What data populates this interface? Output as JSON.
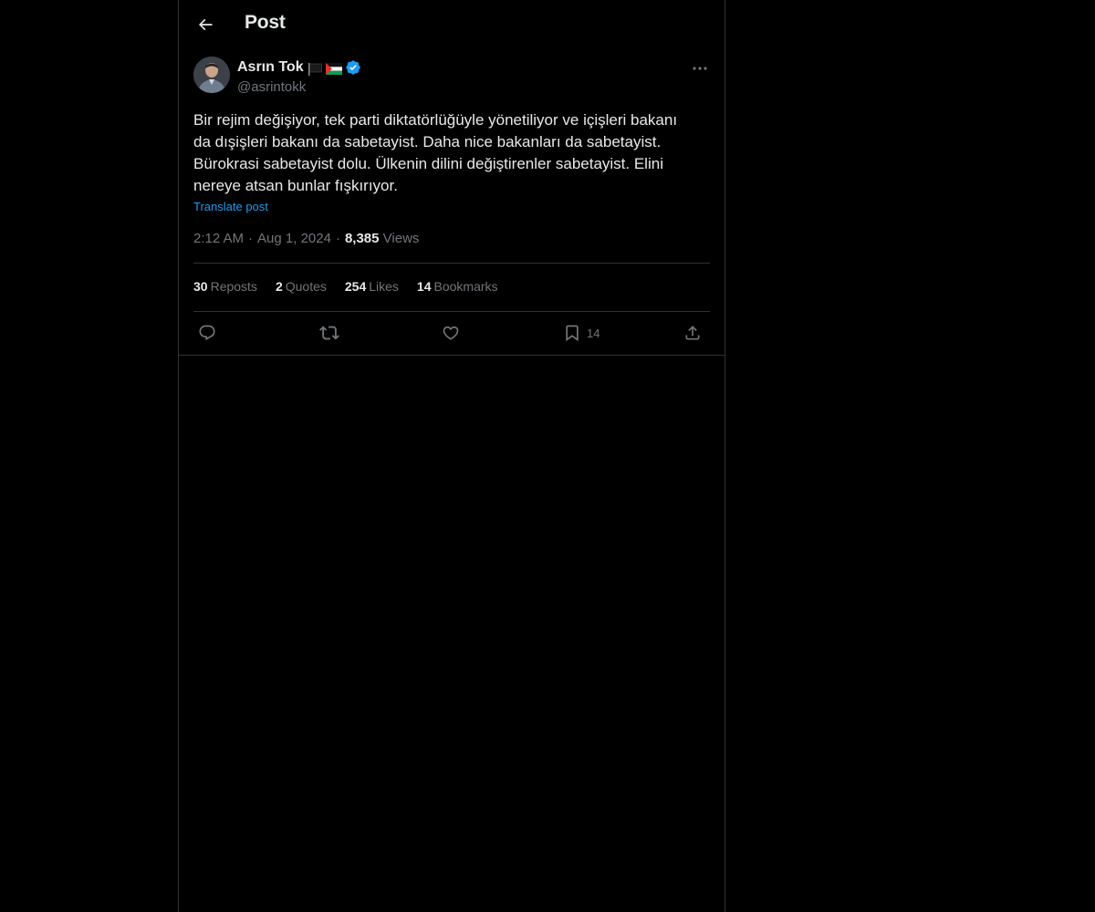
{
  "header": {
    "title": "Post"
  },
  "post": {
    "author": {
      "name": "Asrın Tok",
      "handle": "@asrintokk",
      "badges": [
        "black-flag-emoji",
        "palestine-flag-emoji",
        "verified-badge"
      ]
    },
    "text": "Bir rejim değişiyor, tek parti diktatörlüğüyle yönetiliyor ve içişleri bakanı da dışişleri bakanı da sabetayist. Daha nice bakanları da sabetayist. Bürokrasi sabetayist dolu. Ülkenin dilini değiştirenler sabetayist. Elini nereye atsan bunlar fışkırıyor.",
    "translate_label": "Translate post",
    "time": "2:12 AM",
    "date": "Aug 1, 2024",
    "views_count": "8,385",
    "views_label": "Views"
  },
  "stats": {
    "reposts_count": "30",
    "reposts_label": "Reposts",
    "quotes_count": "2",
    "quotes_label": "Quotes",
    "likes_count": "254",
    "likes_label": "Likes",
    "bookmarks_count": "14",
    "bookmarks_label": "Bookmarks"
  },
  "actions": {
    "bookmark_count": "14"
  },
  "colors": {
    "background": "#000000",
    "text_primary": "#e7e9ea",
    "text_secondary": "#71767b",
    "accent": "#1d9bf0",
    "border": "#2f3336"
  }
}
